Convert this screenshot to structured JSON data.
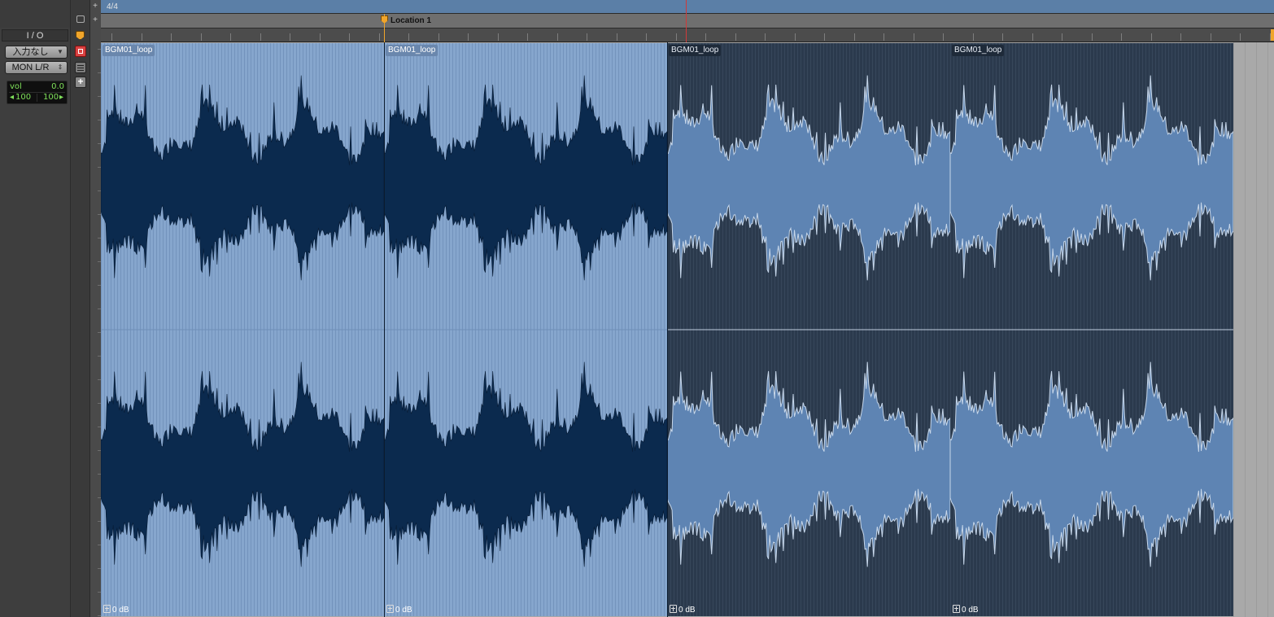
{
  "meter_ruler": {
    "meter": "4/4"
  },
  "marker_ruler": {
    "location_label": "Location 1"
  },
  "track": {
    "io_label": "I / O",
    "input_select": "入力なし",
    "output_select": "MON L/R",
    "volume": {
      "label": "vol",
      "value": "0.0",
      "pan_left": "100",
      "pan_right": "100"
    }
  },
  "icons": [
    "plus-icon",
    "collapse-icon",
    "marker-icon",
    "record-enable-icon",
    "comment-icon",
    "add-icon"
  ],
  "colors": {
    "selected_clip": "#86a6cd",
    "selected_wave": "#0b2a4e",
    "unselected_clip": "#2b3a4d",
    "unselected_wave": "#5e84b3",
    "playhead": "#d03a3a",
    "marker": "#f0a52b"
  },
  "clips": [
    {
      "name": "BGM01_loop",
      "gain": "0 dB",
      "selected": true
    },
    {
      "name": "BGM01_loop",
      "gain": "0 dB",
      "selected": true
    },
    {
      "name": "BGM01_loop",
      "gain": "0 dB",
      "selected": false
    },
    {
      "name": "BGM01_loop",
      "gain": "0 dB",
      "selected": false
    }
  ]
}
